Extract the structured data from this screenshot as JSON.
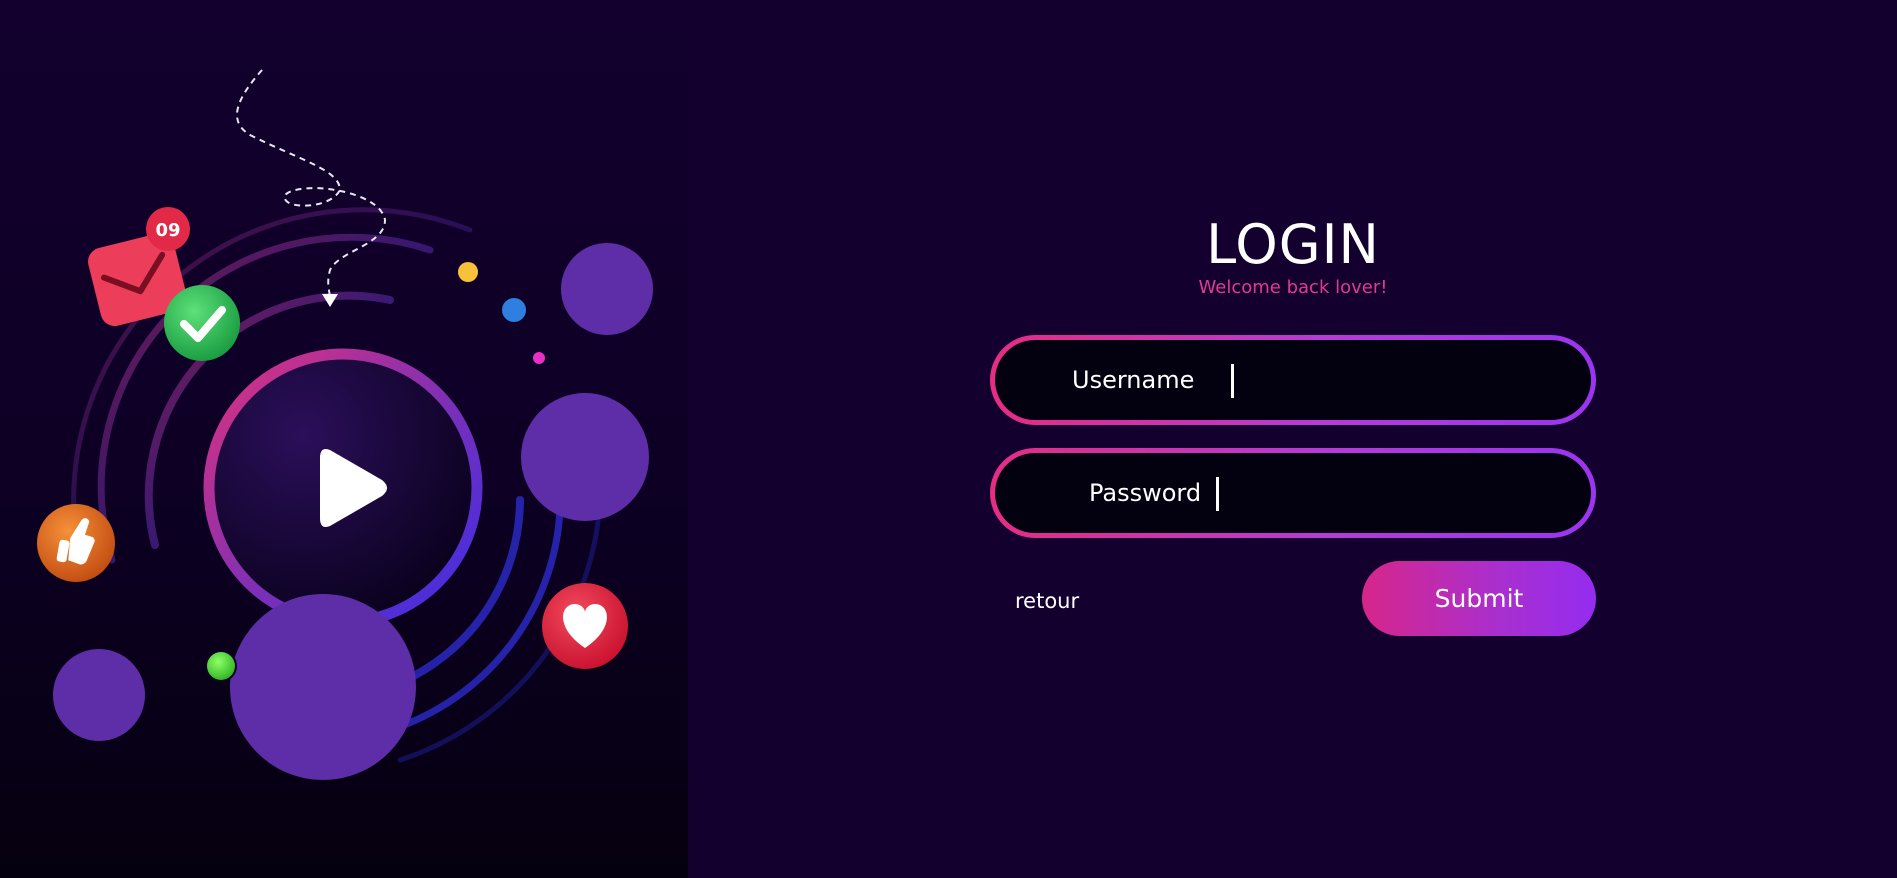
{
  "login": {
    "title": "LOGIN",
    "subtitle": "Welcome back lover!",
    "username_label": "Username",
    "password_label": "Password",
    "back_label": "retour",
    "submit_label": "Submit"
  },
  "illustration": {
    "badge_count": "09",
    "icons": [
      "mail-icon",
      "check-icon",
      "thumbs-up-icon",
      "heart-icon",
      "play-icon"
    ]
  },
  "colors": {
    "background": "#13002e",
    "accent_pink": "#e52d82",
    "accent_purple": "#9a35f0",
    "circle_purple": "#5e2ea8"
  }
}
